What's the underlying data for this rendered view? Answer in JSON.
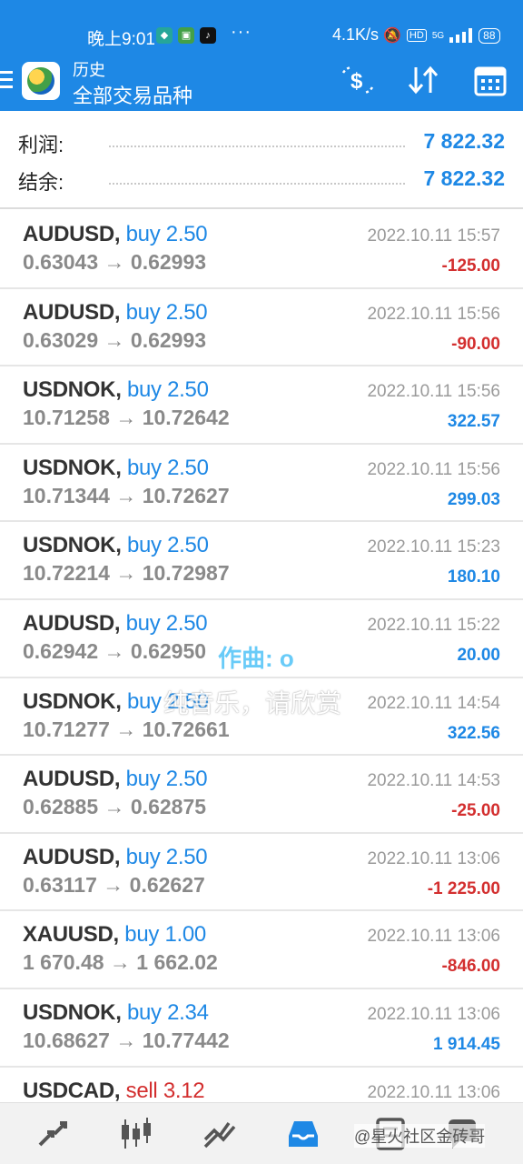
{
  "status": {
    "time": "晚上9:01",
    "dots": "···",
    "speed": "4.1K/s",
    "battery": "88",
    "signal": "5G"
  },
  "header": {
    "subtitle": "历史",
    "title": "全部交易品种"
  },
  "summary": {
    "profit_label": "利润:",
    "profit_value": "7 822.32",
    "balance_label": "结余:",
    "balance_value": "7 822.32"
  },
  "deals": [
    {
      "symbol": "AUDUSD,",
      "side": "buy",
      "volume": "2.50",
      "prices": "0.63043 → 0.62993",
      "time": "2022.10.11 15:57",
      "profit": "-125.00",
      "sign": "neg"
    },
    {
      "symbol": "AUDUSD,",
      "side": "buy",
      "volume": "2.50",
      "prices": "0.63029 → 0.62993",
      "time": "2022.10.11 15:56",
      "profit": "-90.00",
      "sign": "neg"
    },
    {
      "symbol": "USDNOK,",
      "side": "buy",
      "volume": "2.50",
      "prices": "10.71258 → 10.72642",
      "time": "2022.10.11 15:56",
      "profit": "322.57",
      "sign": "pos"
    },
    {
      "symbol": "USDNOK,",
      "side": "buy",
      "volume": "2.50",
      "prices": "10.71344 → 10.72627",
      "time": "2022.10.11 15:56",
      "profit": "299.03",
      "sign": "pos"
    },
    {
      "symbol": "USDNOK,",
      "side": "buy",
      "volume": "2.50",
      "prices": "10.72214 → 10.72987",
      "time": "2022.10.11 15:23",
      "profit": "180.10",
      "sign": "pos"
    },
    {
      "symbol": "AUDUSD,",
      "side": "buy",
      "volume": "2.50",
      "prices": "0.62942 → 0.62950",
      "time": "2022.10.11 15:22",
      "profit": "20.00",
      "sign": "pos"
    },
    {
      "symbol": "USDNOK,",
      "side": "buy",
      "volume": "2.50",
      "prices": "10.71277 → 10.72661",
      "time": "2022.10.11 14:54",
      "profit": "322.56",
      "sign": "pos"
    },
    {
      "symbol": "AUDUSD,",
      "side": "buy",
      "volume": "2.50",
      "prices": "0.62885 → 0.62875",
      "time": "2022.10.11 14:53",
      "profit": "-25.00",
      "sign": "neg"
    },
    {
      "symbol": "AUDUSD,",
      "side": "buy",
      "volume": "2.50",
      "prices": "0.63117 → 0.62627",
      "time": "2022.10.11 13:06",
      "profit": "-1 225.00",
      "sign": "neg"
    },
    {
      "symbol": "XAUUSD,",
      "side": "buy",
      "volume": "1.00",
      "prices": "1 670.48 → 1 662.02",
      "time": "2022.10.11 13:06",
      "profit": "-846.00",
      "sign": "neg"
    },
    {
      "symbol": "USDNOK,",
      "side": "buy",
      "volume": "2.34",
      "prices": "10.68627 → 10.77442",
      "time": "2022.10.11 13:06",
      "profit": "1 914.45",
      "sign": "pos"
    },
    {
      "symbol": "USDCAD,",
      "side": "sell",
      "volume": "3.12",
      "prices": "",
      "time": "2022.10.11 13:06",
      "profit": "",
      "sign": "neg"
    }
  ],
  "overlay": {
    "line1": "作曲: o",
    "line2": "纯音乐，请欣赏"
  },
  "watermark": "@星火社区金砖哥",
  "icons": {
    "menu": "menu-icon",
    "dollar": "dollar-exchange-icon",
    "sort": "sort-icon",
    "calendar": "calendar-icon",
    "nav": [
      "quotes-icon",
      "chart-icon",
      "trade-icon",
      "history-icon",
      "news-icon",
      "chat-icon"
    ]
  },
  "colors": {
    "primary": "#1e88e5",
    "loss": "#d32f2f"
  }
}
